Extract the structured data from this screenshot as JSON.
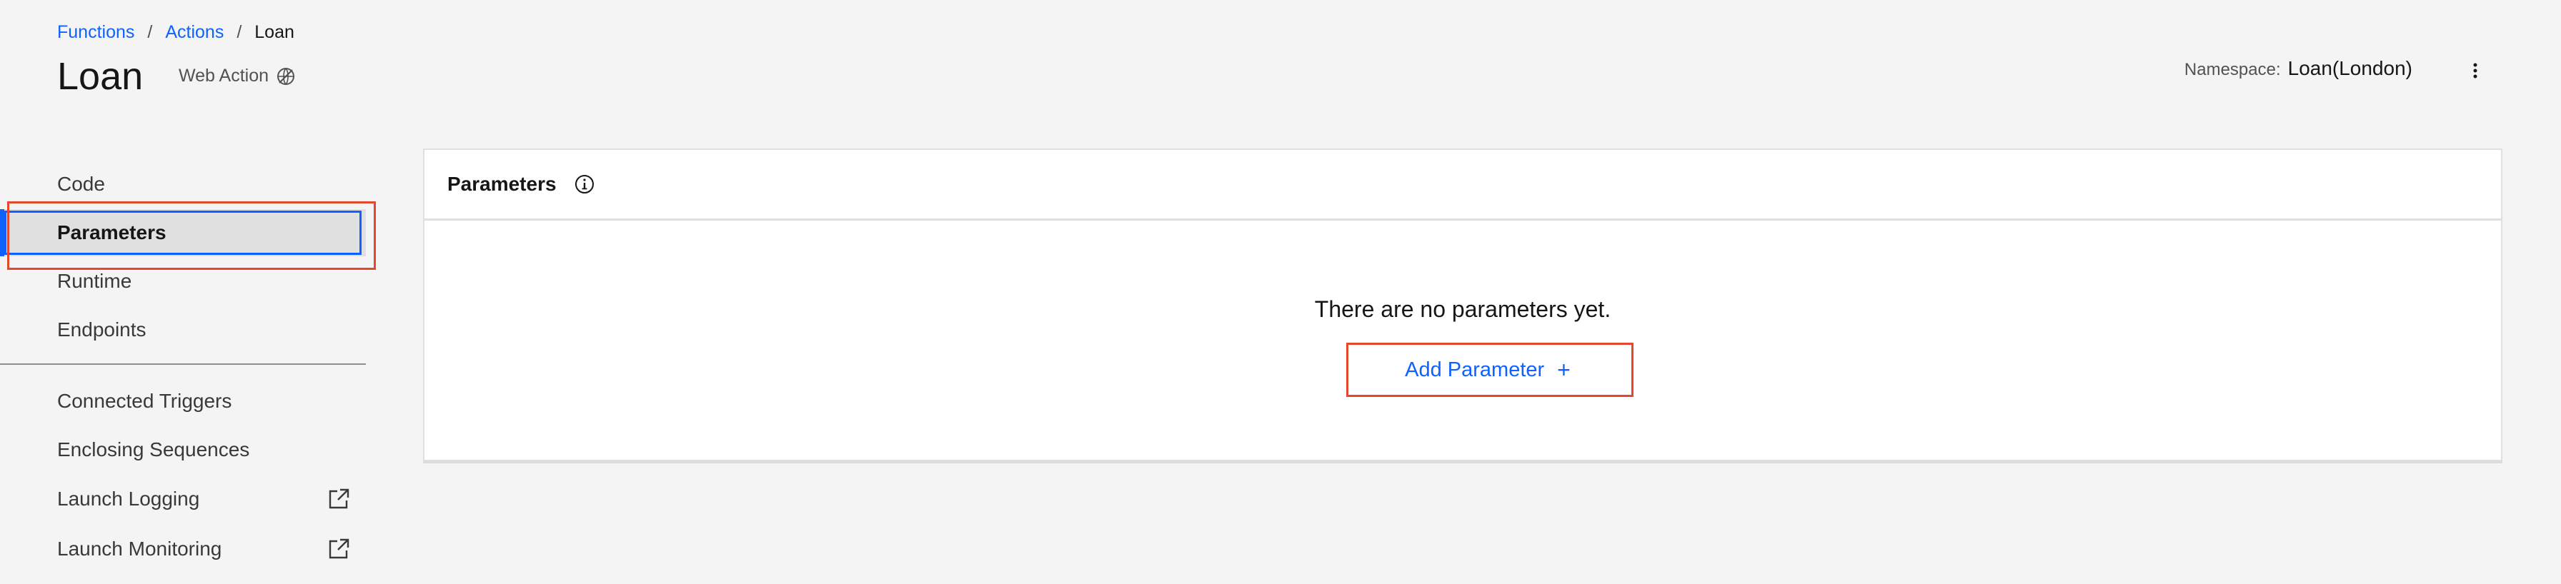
{
  "breadcrumb": {
    "items": [
      {
        "label": "Functions"
      },
      {
        "label": "Actions"
      },
      {
        "label": "Loan"
      }
    ],
    "separator": "/"
  },
  "page": {
    "title": "Loan",
    "subtitle": "Web Action",
    "subtitle_icon": "web-action-disabled-icon"
  },
  "namespace": {
    "label": "Namespace:",
    "value": "Loan(London)"
  },
  "sidebar": {
    "items": [
      {
        "label": "Code"
      },
      {
        "label": "Parameters",
        "active": true
      },
      {
        "label": "Runtime"
      },
      {
        "label": "Endpoints"
      },
      {
        "label": "Connected Triggers"
      },
      {
        "label": "Enclosing Sequences"
      },
      {
        "label": "Launch Logging",
        "icon": "external-link-icon"
      },
      {
        "label": "Launch Monitoring",
        "icon": "external-link-icon"
      }
    ]
  },
  "panel": {
    "title": "Parameters",
    "info_icon": "info-icon",
    "empty_message": "There are no parameters yet.",
    "add_label": "Add Parameter",
    "add_icon": "+"
  },
  "colors": {
    "link": "#0f62fe",
    "highlight": "#e5482d",
    "background": "#f4f4f4",
    "active_bg": "#e0e0e0"
  }
}
